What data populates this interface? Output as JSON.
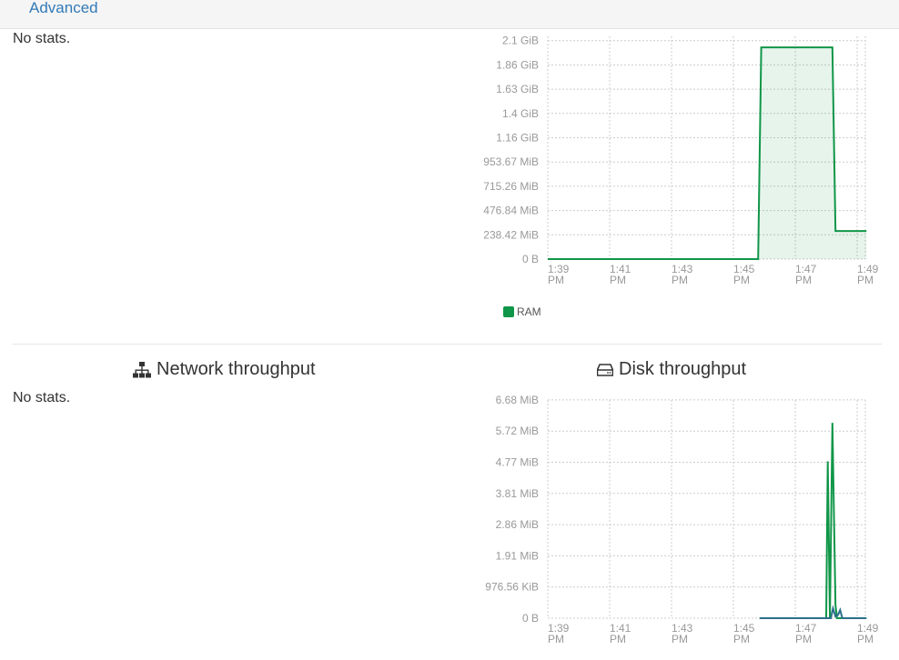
{
  "tabs": {
    "advanced": "Advanced"
  },
  "panels": {
    "left_top": {
      "empty_text": "No stats."
    },
    "network": {
      "title": "Network throughput",
      "empty_text": "No stats."
    },
    "disk": {
      "title": "Disk throughput"
    }
  },
  "colors": {
    "ram": "#109648",
    "read": "#109648",
    "write": "#2d6e8c",
    "grid": "#cccccc"
  },
  "chart_data": [
    {
      "type": "area",
      "title": "",
      "x_ticks": [
        "1:39 PM",
        "1:41 PM",
        "1:43 PM",
        "1:45 PM",
        "1:47 PM",
        "1:49 PM"
      ],
      "y_ticks": [
        "0 B",
        "238.42 MiB",
        "476.84 MiB",
        "715.26 MiB",
        "953.67 MiB",
        "1.16 GiB",
        "1.4 GiB",
        "1.63 GiB",
        "1.86 GiB",
        "2.1 GiB"
      ],
      "ylim_mib": [
        0,
        2146
      ],
      "grid": true,
      "legend_position": "bottom-left",
      "series": [
        {
          "name": "RAM",
          "x_minutes": [
            0,
            6.8,
            6.9,
            9.2,
            9.3,
            10.3
          ],
          "values_mib": [
            0,
            0,
            2040,
            2040,
            270,
            270
          ]
        }
      ]
    },
    {
      "type": "line",
      "title": "",
      "x_ticks": [
        "1:39 PM",
        "1:41 PM",
        "1:43 PM",
        "1:45 PM",
        "1:47 PM",
        "1:49 PM"
      ],
      "y_ticks": [
        "0 B",
        "976.56 KiB",
        "1.91 MiB",
        "2.86 MiB",
        "3.81 MiB",
        "4.77 MiB",
        "5.72 MiB",
        "6.68 MiB"
      ],
      "ylim_mib": [
        0,
        6.68
      ],
      "grid": true,
      "series": [
        {
          "x_minutes": [
            6.85,
            9.0,
            9.05,
            9.12,
            9.2,
            9.3,
            9.35,
            9.45,
            10.3
          ],
          "values_mib": [
            0,
            0,
            4.8,
            0,
            5.98,
            0.4,
            0,
            0,
            0
          ]
        },
        {
          "x_minutes": [
            6.85,
            9.15,
            9.22,
            9.3,
            9.38,
            9.45,
            9.52,
            10.3
          ],
          "values_mib": [
            0,
            0,
            0.3,
            0.05,
            0.1,
            0.25,
            0,
            0
          ]
        }
      ]
    }
  ]
}
